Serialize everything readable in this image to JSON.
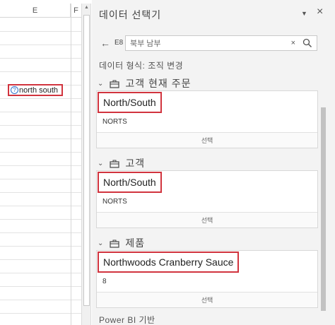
{
  "sheet": {
    "column_e": "E",
    "column_f": "F",
    "selected_cell_text": "north south",
    "selected_cell_icon": "question-icon"
  },
  "pane": {
    "title": "데이터 선택기",
    "menu_icon": "chevron-down-icon",
    "close_icon": "close-icon",
    "back_icon": "arrow-left-icon",
    "cell_ref": "E8",
    "search_value": "북부 남부",
    "search_clear": "×",
    "data_type_label": "데이터 형식: 조직 변경",
    "footer": "Power BI 기반"
  },
  "groups": [
    {
      "label": "고객 현재 주문",
      "card_title": "North/South",
      "card_sub": "NORTS",
      "button": "선택"
    },
    {
      "label": "고객",
      "card_title": "North/South",
      "card_sub": "NORTS",
      "button": "선택"
    },
    {
      "label": "제품",
      "card_title": "Northwoods Cranberry Sauce",
      "card_sub": "8",
      "button": "선택"
    }
  ],
  "colors": {
    "highlight_border": "#d1343e",
    "pane_background": "#f3f3f3",
    "icon_blue": "#2f6fc9"
  }
}
